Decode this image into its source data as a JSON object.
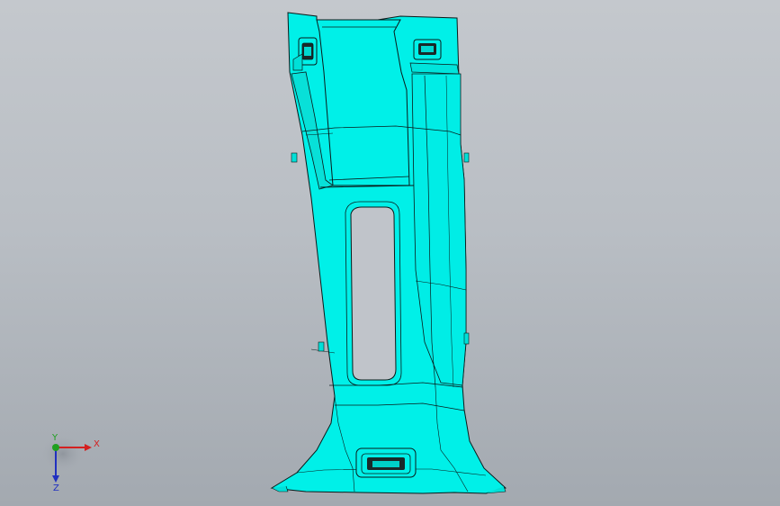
{
  "viewport": {
    "model_color": "#00f0e8",
    "edge_color": "#0a1a1a",
    "cutout_color": "#c0c4ca"
  },
  "triad": {
    "x_label": "X",
    "y_label": "Y",
    "z_label": "Z",
    "x_color": "#d42020",
    "y_color": "#20a020",
    "z_color": "#2030c0"
  }
}
